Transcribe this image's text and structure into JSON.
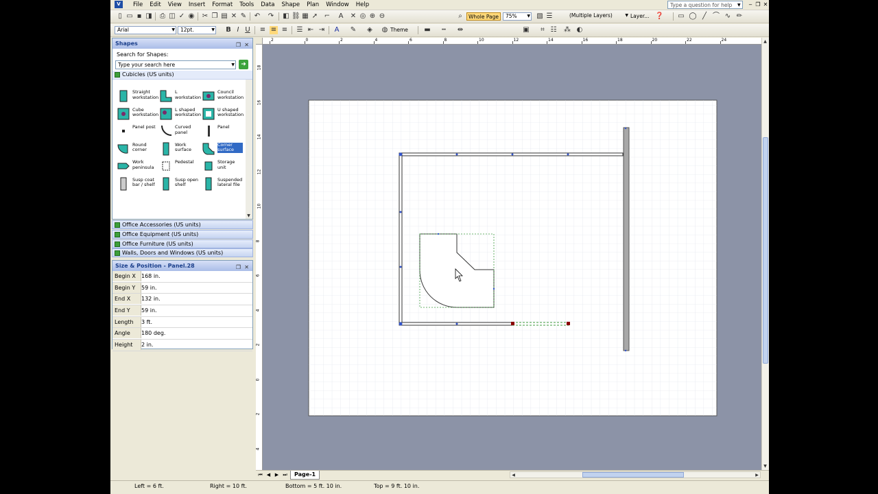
{
  "menubar": {
    "items": [
      "File",
      "Edit",
      "View",
      "Insert",
      "Format",
      "Tools",
      "Data",
      "Shape",
      "Plan",
      "Window",
      "Help"
    ],
    "help_placeholder": "Type a question for help"
  },
  "standard_toolbar": {
    "zoom_button": "Whole Page",
    "zoom_level": "75%",
    "layer_combo": "(Multiple Layers)",
    "layer_button": "Layer..."
  },
  "format_toolbar": {
    "font": "Arial",
    "font_size": "12pt.",
    "theme_label": "Theme"
  },
  "shapes_pane": {
    "title": "Shapes",
    "search_label": "Search for Shapes:",
    "search_placeholder": "Type your search here",
    "open_stencil": "Cubicles (US units)",
    "masters": [
      {
        "label": "Straight workstation",
        "icon": "straight-workstation"
      },
      {
        "label": "L workstation",
        "icon": "l-workstation"
      },
      {
        "label": "Council workstation",
        "icon": "council-workstation"
      },
      {
        "label": "Cube workstation",
        "icon": "cube-workstation"
      },
      {
        "label": "L shaped workstation",
        "icon": "l-shaped-workstation"
      },
      {
        "label": "U shaped workstation",
        "icon": "u-shaped-workstation"
      },
      {
        "label": "Panel post",
        "icon": "panel-post"
      },
      {
        "label": "Curved panel",
        "icon": "curved-panel"
      },
      {
        "label": "Panel",
        "icon": "panel"
      },
      {
        "label": "Round corner",
        "icon": "round-corner"
      },
      {
        "label": "Work surface",
        "icon": "work-surface"
      },
      {
        "label": "Corner surface",
        "icon": "corner-surface",
        "selected": true
      },
      {
        "label": "Work peninsula",
        "icon": "work-peninsula"
      },
      {
        "label": "Pedestal",
        "icon": "pedestal"
      },
      {
        "label": "Storage unit",
        "icon": "storage-unit"
      },
      {
        "label": "Susp coat bar / shelf",
        "icon": "susp-coat-bar"
      },
      {
        "label": "Susp open shelf",
        "icon": "susp-open-shelf"
      },
      {
        "label": "Suspended lateral file",
        "icon": "suspended-lateral-file"
      }
    ],
    "other_stencils": [
      "Office Accessories (US units)",
      "Office Equipment (US units)",
      "Office Furniture (US units)",
      "Walls, Doors and Windows (US units)"
    ]
  },
  "size_position": {
    "title": "Size & Position - Panel.28",
    "rows": [
      {
        "label": "Begin X",
        "value": "168 in."
      },
      {
        "label": "Begin Y",
        "value": "59 in."
      },
      {
        "label": "End X",
        "value": "132 in."
      },
      {
        "label": "End Y",
        "value": "59 in."
      },
      {
        "label": "Length",
        "value": "3 ft."
      },
      {
        "label": "Angle",
        "value": "180 deg."
      },
      {
        "label": "Height",
        "value": "2 in."
      }
    ]
  },
  "ruler": {
    "h_ticks": [
      "2",
      "0",
      "2",
      "4",
      "6",
      "8",
      "10",
      "12",
      "14",
      "16",
      "18",
      "20",
      "22",
      "24"
    ],
    "v_ticks": [
      "18",
      "16",
      "14",
      "12",
      "10",
      "8",
      "6",
      "4",
      "2",
      "0",
      "2",
      "4",
      "6"
    ]
  },
  "page_tabs": {
    "active": "Page-1"
  },
  "status": {
    "left": "Left = 6 ft.",
    "right": "Right = 10 ft.",
    "bottom": "Bottom = 5 ft. 10 in.",
    "top": "Top = 9 ft. 10 in."
  },
  "colors": {
    "canvas_background": "#8c93a7",
    "shape_teal": "#2bb5a8",
    "selection_green": "#3c9a3c",
    "handle_blue": "#3355cc",
    "handle_red": "#8b0000"
  }
}
